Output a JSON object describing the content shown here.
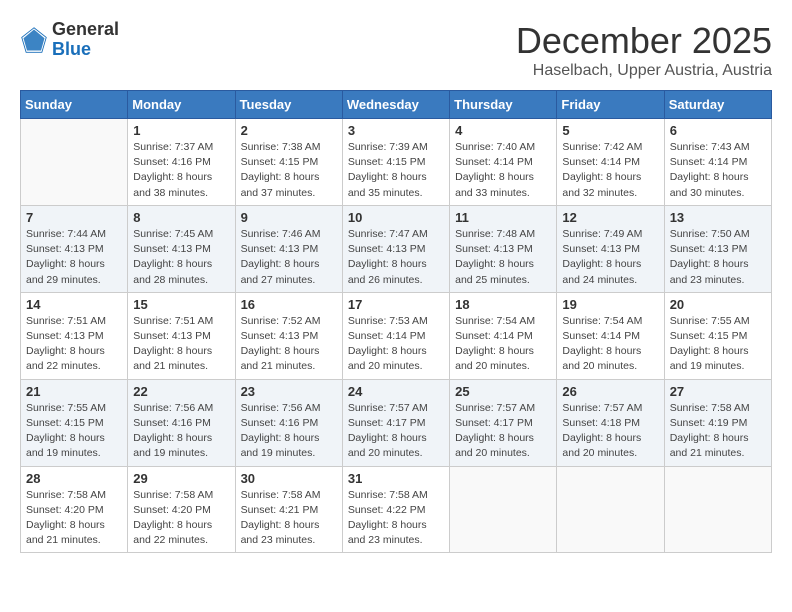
{
  "header": {
    "logo_general": "General",
    "logo_blue": "Blue",
    "month": "December 2025",
    "location": "Haselbach, Upper Austria, Austria"
  },
  "days_of_week": [
    "Sunday",
    "Monday",
    "Tuesday",
    "Wednesday",
    "Thursday",
    "Friday",
    "Saturday"
  ],
  "weeks": [
    [
      {
        "day": "",
        "info": ""
      },
      {
        "day": "1",
        "info": "Sunrise: 7:37 AM\nSunset: 4:16 PM\nDaylight: 8 hours\nand 38 minutes."
      },
      {
        "day": "2",
        "info": "Sunrise: 7:38 AM\nSunset: 4:15 PM\nDaylight: 8 hours\nand 37 minutes."
      },
      {
        "day": "3",
        "info": "Sunrise: 7:39 AM\nSunset: 4:15 PM\nDaylight: 8 hours\nand 35 minutes."
      },
      {
        "day": "4",
        "info": "Sunrise: 7:40 AM\nSunset: 4:14 PM\nDaylight: 8 hours\nand 33 minutes."
      },
      {
        "day": "5",
        "info": "Sunrise: 7:42 AM\nSunset: 4:14 PM\nDaylight: 8 hours\nand 32 minutes."
      },
      {
        "day": "6",
        "info": "Sunrise: 7:43 AM\nSunset: 4:14 PM\nDaylight: 8 hours\nand 30 minutes."
      }
    ],
    [
      {
        "day": "7",
        "info": "Sunrise: 7:44 AM\nSunset: 4:13 PM\nDaylight: 8 hours\nand 29 minutes."
      },
      {
        "day": "8",
        "info": "Sunrise: 7:45 AM\nSunset: 4:13 PM\nDaylight: 8 hours\nand 28 minutes."
      },
      {
        "day": "9",
        "info": "Sunrise: 7:46 AM\nSunset: 4:13 PM\nDaylight: 8 hours\nand 27 minutes."
      },
      {
        "day": "10",
        "info": "Sunrise: 7:47 AM\nSunset: 4:13 PM\nDaylight: 8 hours\nand 26 minutes."
      },
      {
        "day": "11",
        "info": "Sunrise: 7:48 AM\nSunset: 4:13 PM\nDaylight: 8 hours\nand 25 minutes."
      },
      {
        "day": "12",
        "info": "Sunrise: 7:49 AM\nSunset: 4:13 PM\nDaylight: 8 hours\nand 24 minutes."
      },
      {
        "day": "13",
        "info": "Sunrise: 7:50 AM\nSunset: 4:13 PM\nDaylight: 8 hours\nand 23 minutes."
      }
    ],
    [
      {
        "day": "14",
        "info": "Sunrise: 7:51 AM\nSunset: 4:13 PM\nDaylight: 8 hours\nand 22 minutes."
      },
      {
        "day": "15",
        "info": "Sunrise: 7:51 AM\nSunset: 4:13 PM\nDaylight: 8 hours\nand 21 minutes."
      },
      {
        "day": "16",
        "info": "Sunrise: 7:52 AM\nSunset: 4:13 PM\nDaylight: 8 hours\nand 21 minutes."
      },
      {
        "day": "17",
        "info": "Sunrise: 7:53 AM\nSunset: 4:14 PM\nDaylight: 8 hours\nand 20 minutes."
      },
      {
        "day": "18",
        "info": "Sunrise: 7:54 AM\nSunset: 4:14 PM\nDaylight: 8 hours\nand 20 minutes."
      },
      {
        "day": "19",
        "info": "Sunrise: 7:54 AM\nSunset: 4:14 PM\nDaylight: 8 hours\nand 20 minutes."
      },
      {
        "day": "20",
        "info": "Sunrise: 7:55 AM\nSunset: 4:15 PM\nDaylight: 8 hours\nand 19 minutes."
      }
    ],
    [
      {
        "day": "21",
        "info": "Sunrise: 7:55 AM\nSunset: 4:15 PM\nDaylight: 8 hours\nand 19 minutes."
      },
      {
        "day": "22",
        "info": "Sunrise: 7:56 AM\nSunset: 4:16 PM\nDaylight: 8 hours\nand 19 minutes."
      },
      {
        "day": "23",
        "info": "Sunrise: 7:56 AM\nSunset: 4:16 PM\nDaylight: 8 hours\nand 19 minutes."
      },
      {
        "day": "24",
        "info": "Sunrise: 7:57 AM\nSunset: 4:17 PM\nDaylight: 8 hours\nand 20 minutes."
      },
      {
        "day": "25",
        "info": "Sunrise: 7:57 AM\nSunset: 4:17 PM\nDaylight: 8 hours\nand 20 minutes."
      },
      {
        "day": "26",
        "info": "Sunrise: 7:57 AM\nSunset: 4:18 PM\nDaylight: 8 hours\nand 20 minutes."
      },
      {
        "day": "27",
        "info": "Sunrise: 7:58 AM\nSunset: 4:19 PM\nDaylight: 8 hours\nand 21 minutes."
      }
    ],
    [
      {
        "day": "28",
        "info": "Sunrise: 7:58 AM\nSunset: 4:20 PM\nDaylight: 8 hours\nand 21 minutes."
      },
      {
        "day": "29",
        "info": "Sunrise: 7:58 AM\nSunset: 4:20 PM\nDaylight: 8 hours\nand 22 minutes."
      },
      {
        "day": "30",
        "info": "Sunrise: 7:58 AM\nSunset: 4:21 PM\nDaylight: 8 hours\nand 23 minutes."
      },
      {
        "day": "31",
        "info": "Sunrise: 7:58 AM\nSunset: 4:22 PM\nDaylight: 8 hours\nand 23 minutes."
      },
      {
        "day": "",
        "info": ""
      },
      {
        "day": "",
        "info": ""
      },
      {
        "day": "",
        "info": ""
      }
    ]
  ]
}
